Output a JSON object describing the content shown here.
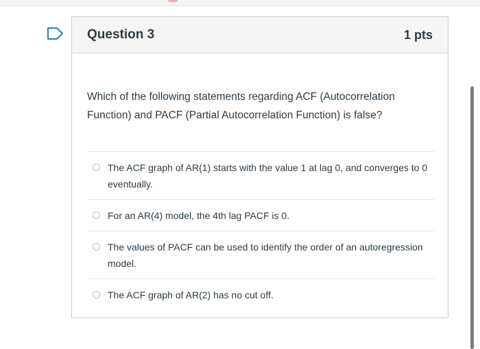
{
  "question": {
    "title": "Question 3",
    "points": "1 pts",
    "text": "Which of the following statements regarding ACF (Autocorrelation Function) and PACF (Partial Autocorrelation Function) is false?",
    "answers": [
      {
        "label": "The ACF graph of AR(1) starts with the value 1 at lag 0, and converges to 0 eventually.",
        "selected": false
      },
      {
        "label": "For an AR(4) model, the 4th lag PACF is 0.",
        "selected": false
      },
      {
        "label": "The values of PACF can be used to identify the order of an autoregression model.",
        "selected": false
      },
      {
        "label": "The ACF graph of AR(2) has no cut off.",
        "selected": false
      }
    ]
  },
  "icons": {
    "flag": "flag-question-icon"
  },
  "colors": {
    "flag": "#2a7cc7",
    "text": "#2d3b45",
    "header_background": "#f5f5f5",
    "border": "#c7cdd1"
  }
}
